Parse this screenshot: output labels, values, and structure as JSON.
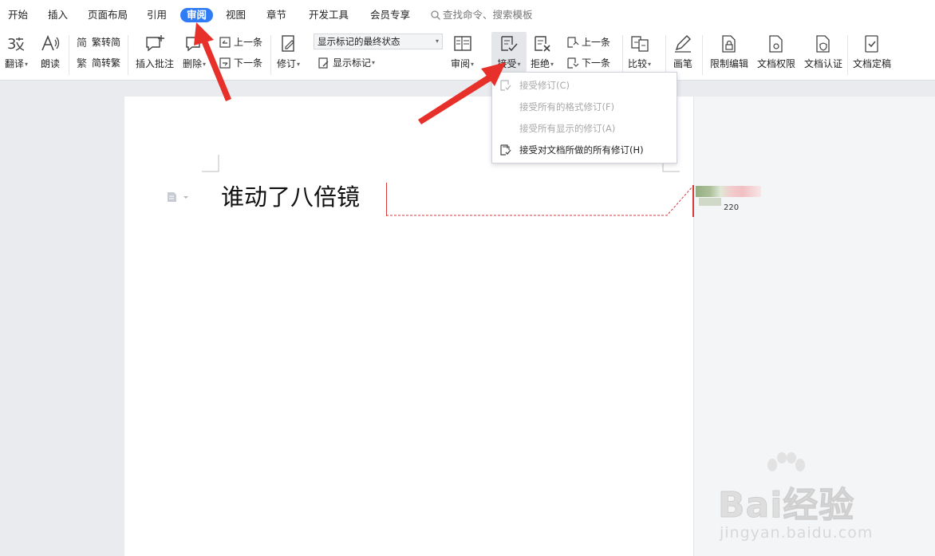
{
  "menu_tabs": [
    {
      "label": "开始"
    },
    {
      "label": "插入"
    },
    {
      "label": "页面布局"
    },
    {
      "label": "引用"
    },
    {
      "label": "审阅"
    },
    {
      "label": "视图"
    },
    {
      "label": "章节"
    },
    {
      "label": "开发工具"
    },
    {
      "label": "会员专享"
    }
  ],
  "search": {
    "label": "查找命令、搜索模板"
  },
  "toolbar": {
    "translate": "翻译",
    "read_aloud": "朗读",
    "trad_to_simp": "繁转简",
    "simp_to_trad": "简转繁",
    "insert_comment": "插入批注",
    "delete": "删除",
    "prev": "上一条",
    "next": "下一条",
    "track_changes": "修订",
    "display_mode": "显示标记的最终状态",
    "show_markup": "显示标记",
    "review": "审阅",
    "accept": "接受",
    "reject": "拒绝",
    "reject_prev": "上一条",
    "reject_next": "下一条",
    "compare": "比较",
    "pen": "画笔",
    "restrict_edit": "限制编辑",
    "doc_rights": "文档权限",
    "doc_cert": "文档认证",
    "doc_finalize": "文档定稿"
  },
  "accept_menu": {
    "items": [
      {
        "label": "接受修订(C)",
        "enabled": false
      },
      {
        "label": "接受所有的格式修订(F)",
        "enabled": false
      },
      {
        "label": "接受所有显示的修订(A)",
        "enabled": false
      },
      {
        "label": "接受对文档所做的所有修订(H)",
        "enabled": true
      }
    ]
  },
  "document": {
    "text": "谁动了八倍镜"
  },
  "comment": {
    "count": "220"
  },
  "watermark": {
    "brand": "Bai经验",
    "url": "jingyan.baidu.com"
  },
  "colors": {
    "accent": "#2f7cf6",
    "annotation_arrow": "#e8302a",
    "revision_line": "#d63a3a"
  }
}
